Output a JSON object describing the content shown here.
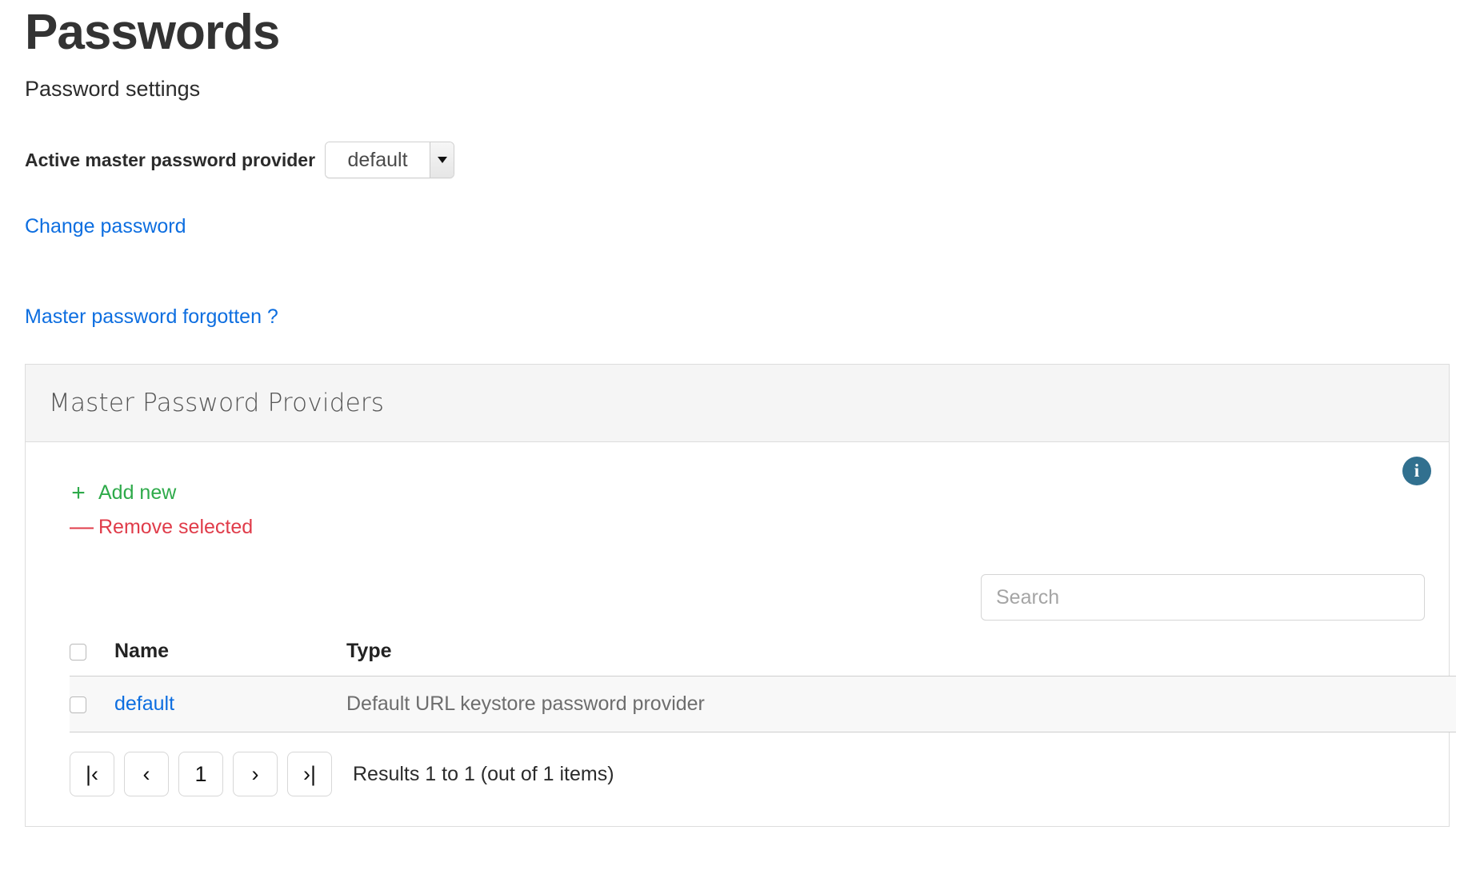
{
  "header": {
    "title": "Passwords",
    "subtitle": "Password settings"
  },
  "provider": {
    "label": "Active master password provider",
    "selected": "default",
    "options": [
      "default"
    ],
    "caret_icon": "chevron-down-icon"
  },
  "links": {
    "change_password": "Change password",
    "master_password_forgotten": "Master password forgotten ?"
  },
  "panel": {
    "title": "Master Password Providers",
    "info_badge": "i",
    "actions": {
      "add_symbol": "+",
      "add_label": "Add new",
      "remove_symbol": "—",
      "remove_label": "Remove selected"
    },
    "search": {
      "placeholder": "Search",
      "value": ""
    },
    "table": {
      "columns": [
        "Name",
        "Type"
      ],
      "rows": [
        {
          "name": "default",
          "type": "Default URL keystore password provider"
        }
      ]
    },
    "pagination": {
      "first": "|‹",
      "prev": "‹",
      "current": "1",
      "next": "›",
      "last": "›|",
      "results_text": "Results 1 to 1 (out of 1 items)"
    }
  },
  "colors": {
    "link": "#0d6ee0",
    "add": "#2eaa4a",
    "remove": "#e03c4a",
    "info": "#31708f",
    "panel_header_bg": "#f5f5f5",
    "row_bg": "#f8f8f8"
  }
}
